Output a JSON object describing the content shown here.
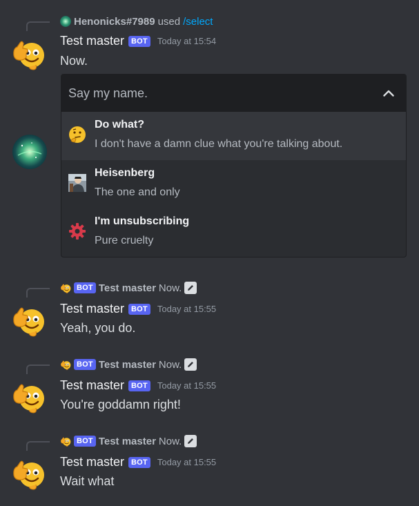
{
  "messages": [
    {
      "reply": {
        "user": "Henonicks#7989",
        "verb": "used",
        "command": "/select"
      },
      "author": "Test master",
      "badge": "BOT",
      "timestamp": "Today at 15:54",
      "content": "Now."
    },
    {
      "reply": {
        "badge": "BOT",
        "user": "Test master",
        "content": "Now."
      },
      "author": "Test master",
      "badge": "BOT",
      "timestamp": "Today at 15:55",
      "content": "Yeah, you do."
    },
    {
      "reply": {
        "badge": "BOT",
        "user": "Test master",
        "content": "Now."
      },
      "author": "Test master",
      "badge": "BOT",
      "timestamp": "Today at 15:55",
      "content": "You're goddamn right!"
    },
    {
      "reply": {
        "badge": "BOT",
        "user": "Test master",
        "content": "Now."
      },
      "author": "Test master",
      "badge": "BOT",
      "timestamp": "Today at 15:55",
      "content": "Wait what"
    }
  ],
  "select_menu": {
    "placeholder": "Say my name.",
    "expanded": true,
    "options": [
      {
        "icon": "thinking-face-icon",
        "label": "Do what?",
        "description": "I don't have a damn clue what you're talking about."
      },
      {
        "icon": "heisenberg-image-icon",
        "label": "Heisenberg",
        "description": "The one and only"
      },
      {
        "icon": "red-gear-icon",
        "label": "I'm unsubscribing",
        "description": "Pure cruelty"
      }
    ]
  },
  "colors": {
    "background": "#313338",
    "bot_badge": "#5865f2",
    "command_link": "#00a8fc"
  }
}
